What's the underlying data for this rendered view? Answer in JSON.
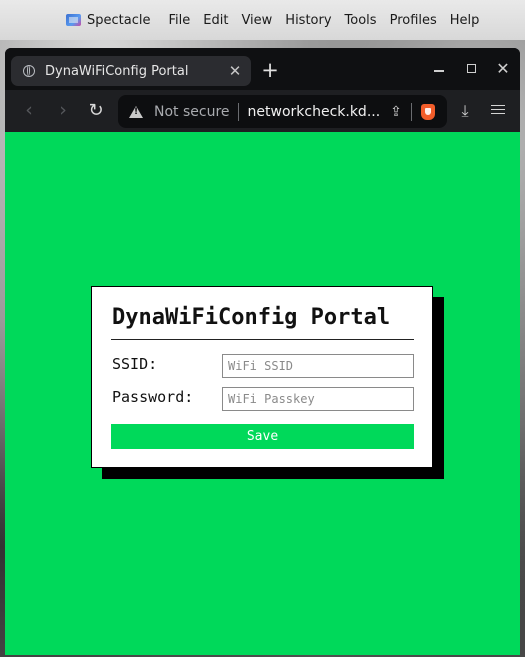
{
  "menubar": {
    "app_icon": "spectacle-icon",
    "app_name": "Spectacle",
    "items": [
      "File",
      "Edit",
      "View",
      "History",
      "Tools",
      "Profiles",
      "Help"
    ]
  },
  "browser": {
    "tab": {
      "icon": "globe-icon",
      "title": "DynaWiFiConfig Portal",
      "close_glyph": "✕"
    },
    "new_tab_glyph": "+",
    "window_controls": {
      "close_glyph": "✕"
    },
    "toolbar": {
      "back_glyph": "‹",
      "forward_glyph": "›",
      "reload_glyph": "↻",
      "security_label": "Not secure",
      "url": "networkcheck.kd...",
      "share_glyph": "⇪",
      "download_glyph": "⤓"
    }
  },
  "portal": {
    "title": "DynaWiFiConfig Portal",
    "ssid_label": "SSID:",
    "ssid_value": "",
    "ssid_placeholder": "WiFi SSID",
    "password_label": "Password:",
    "password_value": "",
    "password_placeholder": "WiFi Passkey",
    "save_label": "Save",
    "colors": {
      "background": "#00d95a",
      "button": "#00d95a",
      "card": "#ffffff",
      "shadow": "#000000"
    }
  }
}
